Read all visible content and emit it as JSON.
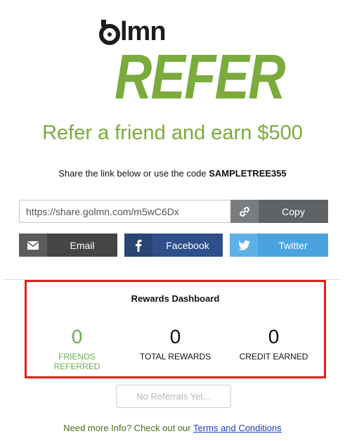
{
  "brand": {
    "logo_text": "lmn",
    "product": "REFER",
    "accent_color": "#7aab3c",
    "logo_icon": "golmn-g-icon"
  },
  "headline": "Refer a friend and earn $500",
  "share": {
    "prefix": "Share the link below or use the code",
    "code": "SAMPLETREE355",
    "link_value": "https://share.golmn.com/m5wC6Dx",
    "copy_label": "Copy",
    "copy_icon": "link-icon"
  },
  "social": {
    "email_label": "Email",
    "email_icon": "envelope-icon",
    "facebook_label": "Facebook",
    "facebook_icon": "facebook-icon",
    "twitter_label": "Twitter",
    "twitter_icon": "twitter-icon"
  },
  "dashboard": {
    "title": "Rewards Dashboard",
    "stats": [
      {
        "value": "0",
        "label": "FRIENDS\nREFERRED"
      },
      {
        "value": "0",
        "label": "TOTAL REWARDS"
      },
      {
        "value": "0",
        "label": "CREDIT EARNED"
      }
    ],
    "highlight_color": "#e61e1e"
  },
  "no_referrals_label": "No Referrals Yet...",
  "footer": {
    "text": "Need more Info? Check out our",
    "link_label": "Terms and Conditions"
  }
}
